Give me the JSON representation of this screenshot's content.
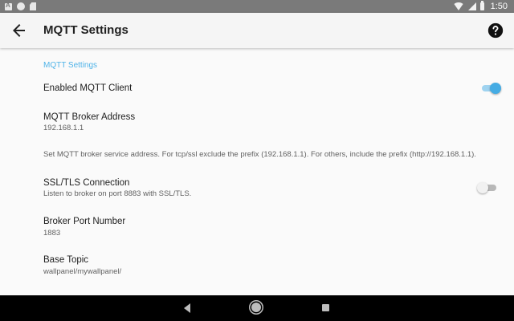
{
  "status_bar": {
    "time": "1:50"
  },
  "app_bar": {
    "title": "MQTT Settings"
  },
  "section": {
    "header": "MQTT Settings"
  },
  "prefs": {
    "enabled_client": {
      "title": "Enabled MQTT Client",
      "checked": true
    },
    "broker_address": {
      "title": "MQTT Broker Address",
      "summary": "192.168.1.1"
    },
    "address_info": {
      "text": "Set MQTT broker service address. For tcp/ssl exclude the prefix (192.168.1.1). For others, include the prefix (http://192.168.1.1)."
    },
    "ssl": {
      "title": "SSL/TLS Connection",
      "summary": "Listen to broker on port 8883 with SSL/TLS.",
      "checked": false
    },
    "port": {
      "title": "Broker Port Number",
      "summary": "1883"
    },
    "base_topic": {
      "title": "Base Topic",
      "summary": "wallpanel/mywallpanel/"
    }
  },
  "colors": {
    "accent": "#4fb3e8",
    "switch_on": "#45ace4",
    "status_bar": "#7a7a7a",
    "nav_bar": "#000000"
  },
  "icons": {
    "back": "arrow-left-icon",
    "help": "help-circle-icon",
    "nav_back": "triangle-back-icon",
    "nav_home": "circle-home-icon",
    "nav_recents": "square-recents-icon"
  }
}
